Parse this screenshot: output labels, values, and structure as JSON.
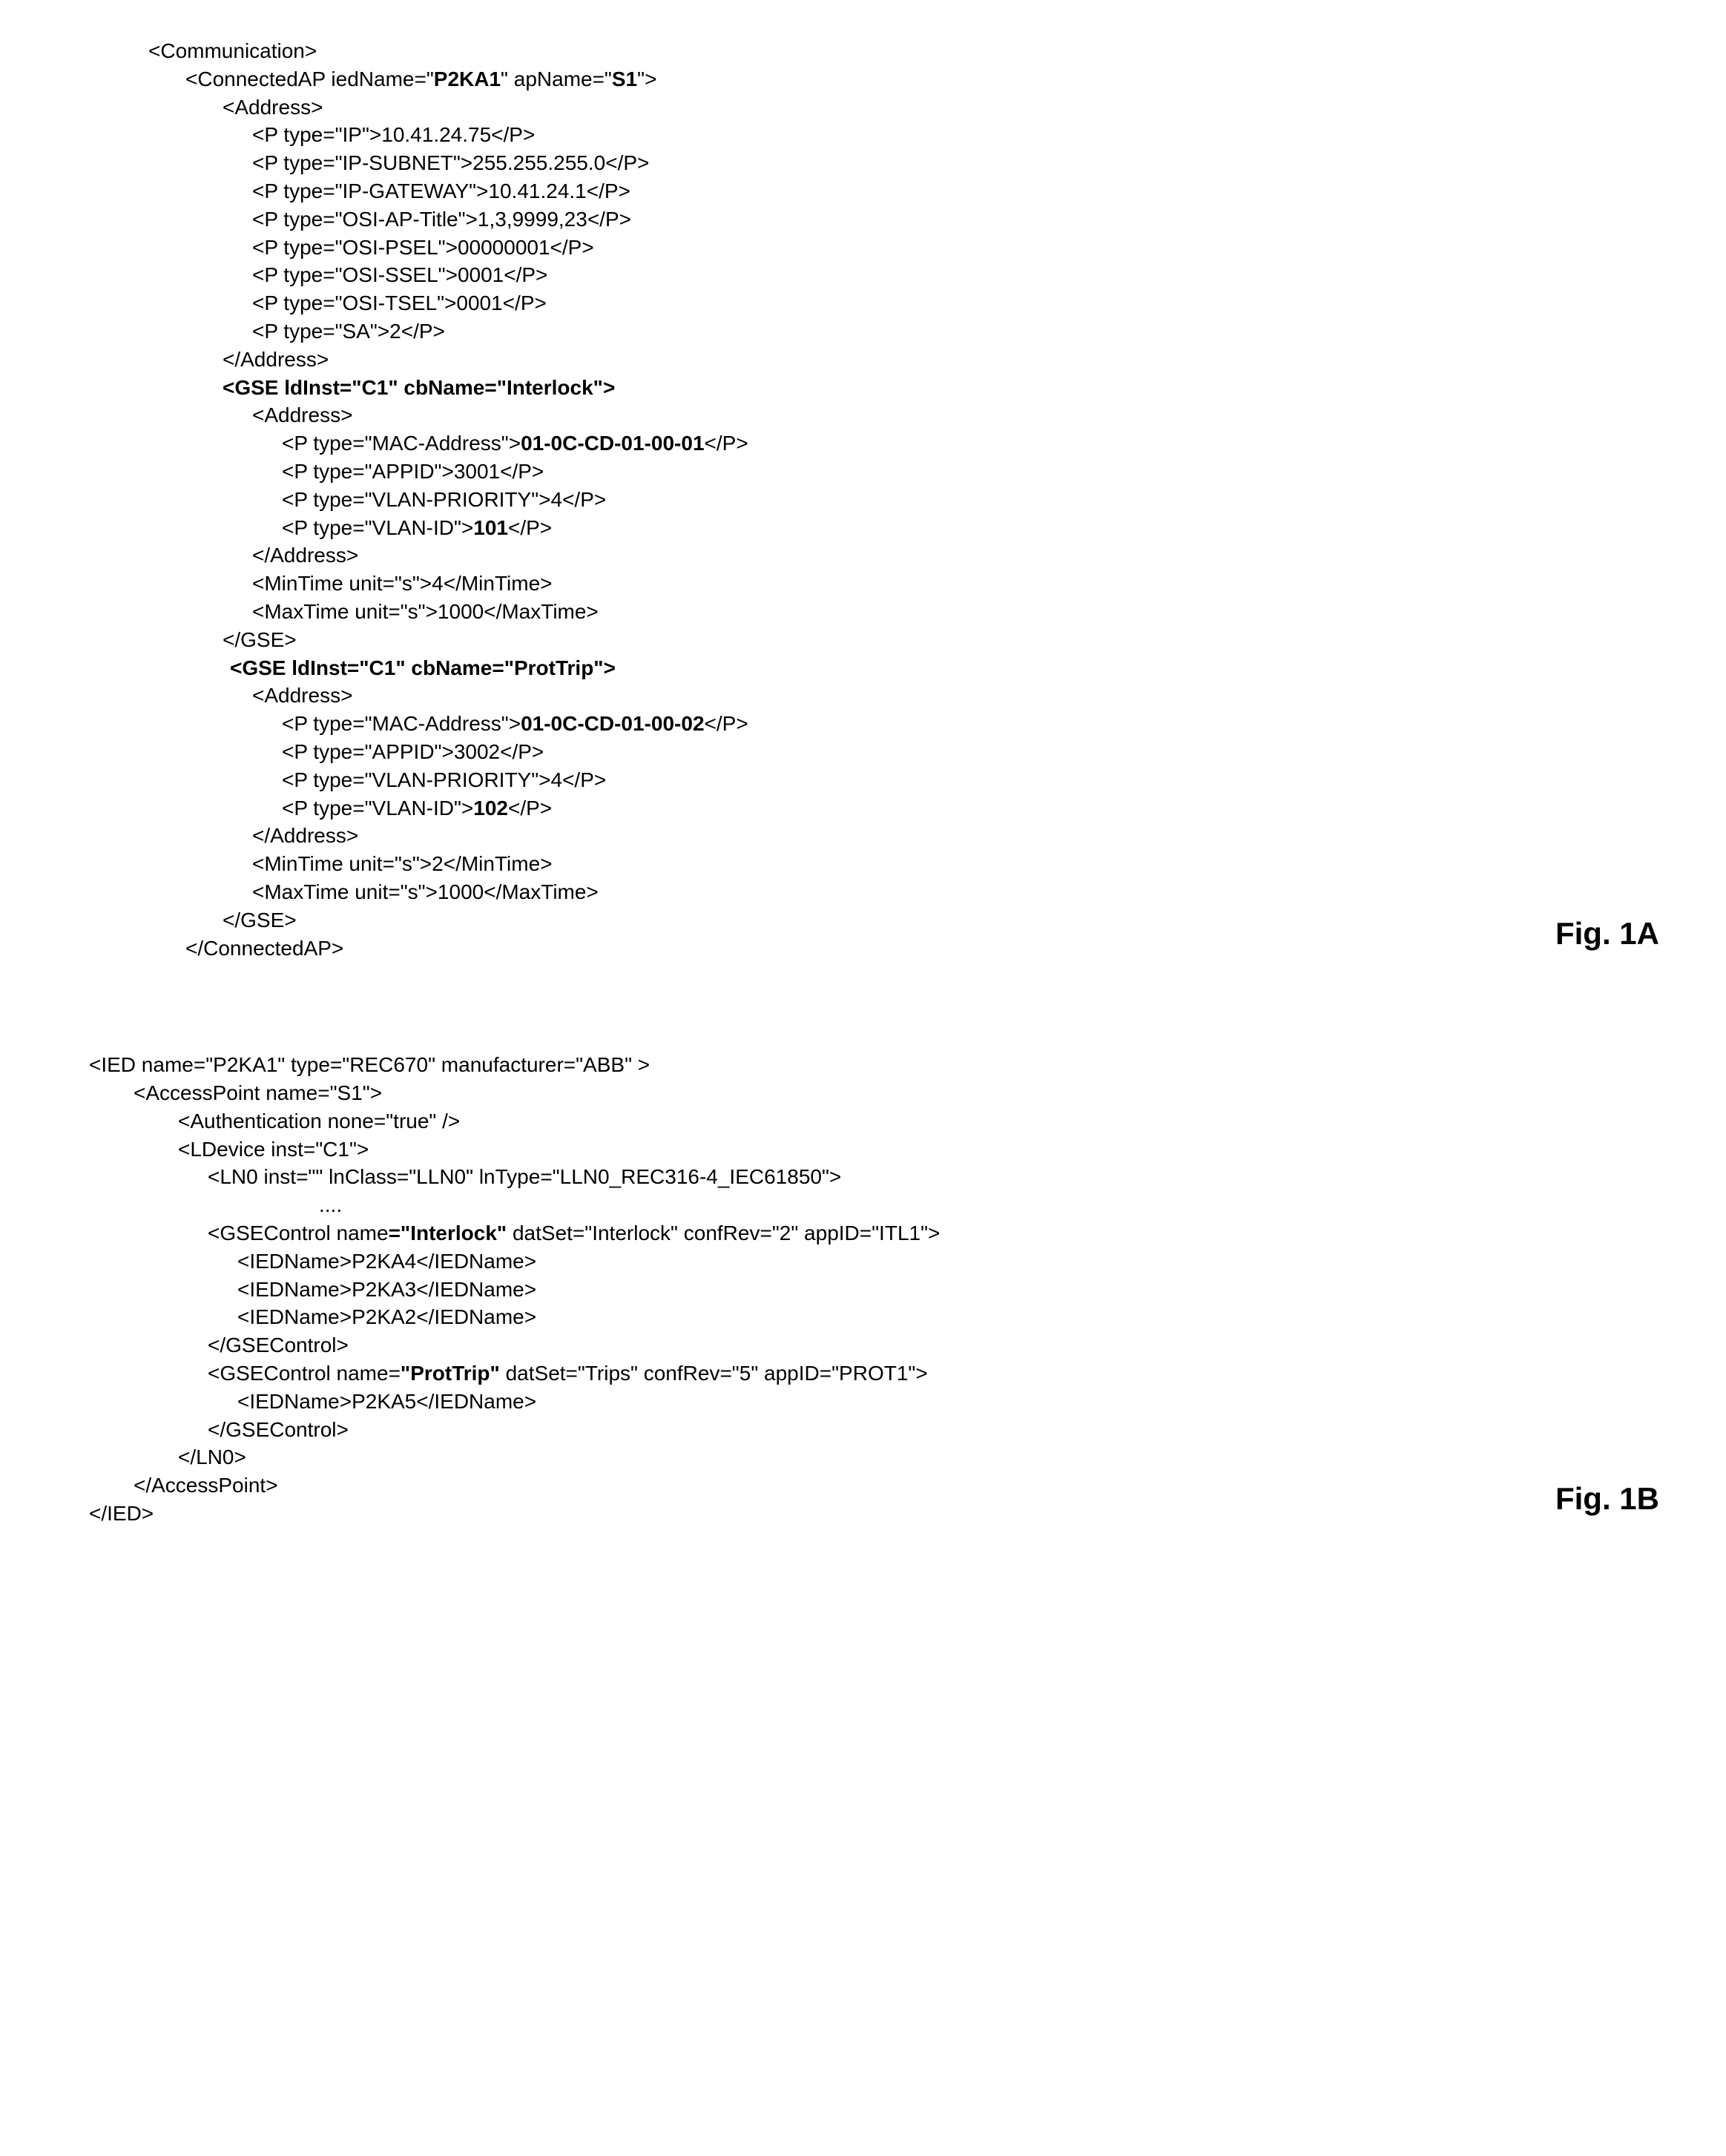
{
  "figA": {
    "label": "Fig. 1A",
    "l1": "<Communication>",
    "l2a": "<ConnectedAP iedName=\"",
    "l2b": "P2KA1",
    "l2c": "\" apName=\"",
    "l2d": "S1",
    "l2e": "\">",
    "l3": "<Address>",
    "l4": "<P type=\"IP\">10.41.24.75</P>",
    "l5": "<P type=\"IP-SUBNET\">255.255.255.0</P>",
    "l6": "<P type=\"IP-GATEWAY\">10.41.24.1</P>",
    "l7": "<P type=\"OSI-AP-Title\">1,3,9999,23</P>",
    "l8": "<P type=\"OSI-PSEL\">00000001</P>",
    "l9": "<P type=\"OSI-SSEL\">0001</P>",
    "l10": "<P type=\"OSI-TSEL\">0001</P>",
    "l11": "<P type=\"SA\">2</P>",
    "l12": "</Address>",
    "l13": "<GSE ldInst=\"C1\" cbName=\"Interlock\">",
    "l14": "<Address>",
    "l15a": "<P type=\"MAC-Address\">",
    "l15b": "01-0C-CD-01-00-01",
    "l15c": "</P>",
    "l16": "<P type=\"APPID\">3001</P>",
    "l17": "<P type=\"VLAN-PRIORITY\">4</P>",
    "l18a": "<P type=\"VLAN-ID\">",
    "l18b": "101",
    "l18c": "</P>",
    "l19": "</Address>",
    "l20": "<MinTime unit=\"s\">4</MinTime>",
    "l21": "<MaxTime unit=\"s\">1000</MaxTime>",
    "l22": "</GSE>",
    "l23": "<GSE ldInst=\"C1\" cbName=\"ProtTrip\">",
    "l24": "<Address>",
    "l25a": "<P type=\"MAC-Address\">",
    "l25b": "01-0C-CD-01-00-02",
    "l25c": "</P>",
    "l26": "<P type=\"APPID\">3002</P>",
    "l27": "<P type=\"VLAN-PRIORITY\">4</P>",
    "l28a": "<P type=\"VLAN-ID\">",
    "l28b": "102",
    "l28c": "</P>",
    "l29": "</Address>",
    "l30": "<MinTime unit=\"s\">2</MinTime>",
    "l31": "<MaxTime unit=\"s\">1000</MaxTime>",
    "l32": "</GSE>",
    "l33": "</ConnectedAP>"
  },
  "figB": {
    "label": "Fig. 1B",
    "l1": "<IED name=\"P2KA1\" type=\"REC670\" manufacturer=\"ABB\" >",
    "l2": "<AccessPoint name=\"S1\">",
    "l3": "<Authentication none=\"true\" />",
    "l4": "<LDevice inst=\"C1\">",
    "l5": "<LN0 inst=\"\" lnClass=\"LLN0\" lnType=\"LLN0_REC316-4_IEC61850\">",
    "l6": "....",
    "l7a": "<GSEControl name",
    "l7b": "=\"Interlock\"",
    "l7c": " datSet=\"Interlock\" confRev=\"2\" appID=\"ITL1\">",
    "l8": "<IEDName>P2KA4</IEDName>",
    "l9": "<IEDName>P2KA3</IEDName>",
    "l10": "<IEDName>P2KA2</IEDName>",
    "l11": "</GSEControl>",
    "l12a": "<GSEControl name=",
    "l12b": "\"ProtTrip\"",
    "l12c": " datSet=\"Trips\" confRev=\"5\" appID=\"PROT1\">",
    "l13": "<IEDName>P2KA5</IEDName>",
    "l14": "</GSEControl>",
    "l15": "</LN0>",
    "l16": "</AccessPoint>",
    "l17": "</IED>"
  }
}
